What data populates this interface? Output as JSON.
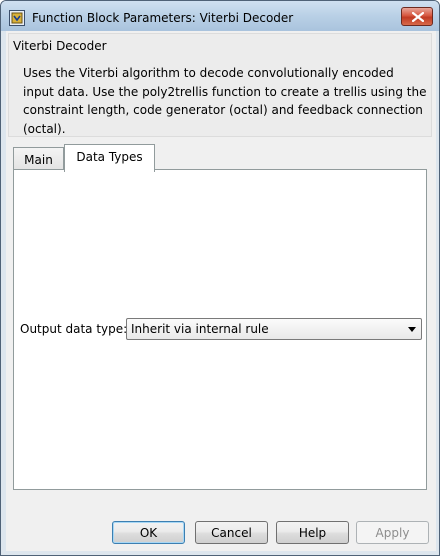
{
  "window": {
    "title": "Function Block Parameters: Viterbi Decoder",
    "close_icon": "close-icon"
  },
  "block": {
    "name": "Viterbi Decoder",
    "description": "Uses the Viterbi algorithm to decode convolutionally encoded input data.  Use the poly2trellis function to create a trellis using the constraint length, code generator (octal) and feedback connection (octal)."
  },
  "tabs": [
    {
      "label": "Main",
      "selected": false
    },
    {
      "label": "Data Types",
      "selected": true
    }
  ],
  "fields": {
    "output_data_type": {
      "label": "Output data type:",
      "value": "Inherit via internal rule"
    }
  },
  "buttons": {
    "ok": "OK",
    "cancel": "Cancel",
    "help": "Help",
    "apply": "Apply"
  },
  "colors": {
    "titlebar": "#b9d0e6",
    "close_button": "#c13a23",
    "dialog_background": "#f0f0f0",
    "panel_background": "#ffffff"
  }
}
